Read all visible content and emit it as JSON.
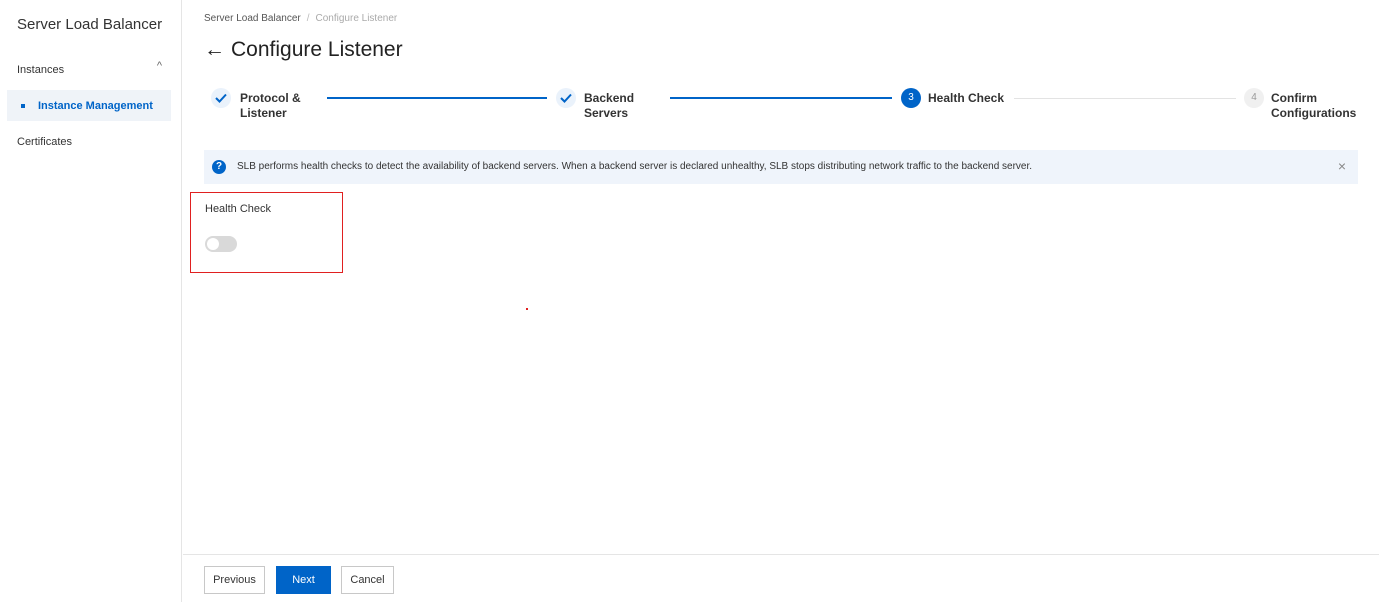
{
  "sidebar": {
    "title": "Server Load Balancer",
    "group_label": "Instances",
    "active_item": "Instance Management",
    "other_item": "Certificates"
  },
  "breadcrumb": {
    "root": "Server Load Balancer",
    "separator": "/",
    "current": "Configure Listener"
  },
  "page": {
    "title": "Configure Listener",
    "back_arrow": "←"
  },
  "steps": [
    {
      "number": "1",
      "label_line1": "Protocol &",
      "label_line2": "Listener",
      "status": "done"
    },
    {
      "number": "2",
      "label_line1": "Backend",
      "label_line2": "Servers",
      "status": "done"
    },
    {
      "number": "3",
      "label_line1": "Health Check",
      "label_line2": "",
      "status": "current"
    },
    {
      "number": "4",
      "label_line1": "Confirm",
      "label_line2": "Configurations",
      "status": "todo"
    }
  ],
  "notice": {
    "icon": "?",
    "text": "SLB performs health checks to detect the availability of backend servers. When a backend server is declared unhealthy, SLB stops distributing network traffic to the backend server.",
    "close": "×"
  },
  "health_check": {
    "label": "Health Check",
    "enabled": false
  },
  "footer": {
    "previous": "Previous",
    "next": "Next",
    "cancel": "Cancel"
  },
  "colors": {
    "accent": "#0064c8",
    "highlight_border": "#e02020"
  }
}
